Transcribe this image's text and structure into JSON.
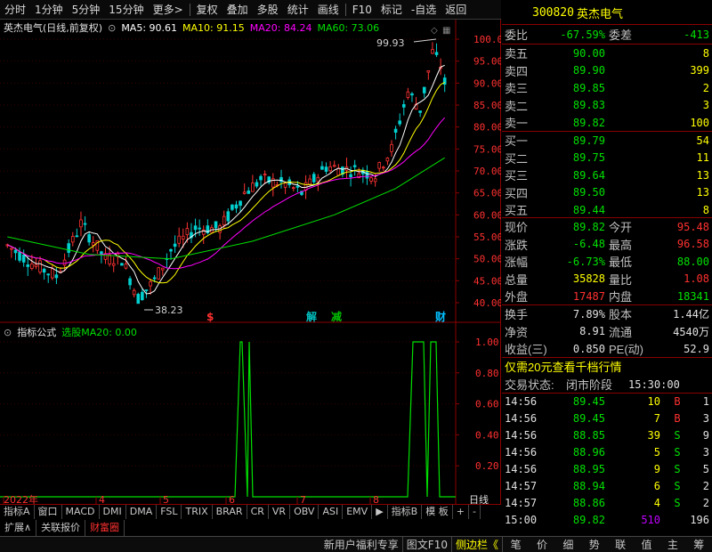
{
  "toolbar": {
    "items": [
      "分时",
      "1分钟",
      "5分钟",
      "15分钟",
      "更多>",
      "复权",
      "叠加",
      "多股",
      "统计",
      "画线",
      "F10",
      "标记",
      "-自选",
      "返回"
    ]
  },
  "chart": {
    "stock_label": "英杰电气(日线,前复权)",
    "ma5": "MA5: 90.61",
    "ma10": "MA10: 91.15",
    "ma20": "MA20: 84.24",
    "ma60": "MA60: 73.06",
    "price_axis": [
      "100.0",
      "95.00",
      "90.00",
      "85.00",
      "80.00",
      "75.00",
      "70.00",
      "65.00",
      "60.00",
      "55.00",
      "50.00",
      "45.00",
      "40.00"
    ],
    "high_label": "99.93",
    "low_label": "38.23",
    "event_markers": [
      {
        "text": "$",
        "color": "#ff3030"
      },
      {
        "text": "解",
        "color": "#00c0c0"
      },
      {
        "text": "减",
        "color": "#00c000"
      },
      {
        "text": "财",
        "color": "#00c0ff"
      }
    ],
    "indicator_title": "指标公式",
    "indicator_value": "选股MA20: 0.00",
    "indicator_axis": [
      "1.00",
      "0.80",
      "0.60",
      "0.40",
      "0.20"
    ],
    "date_axis": [
      "2022年",
      "4",
      "5",
      "6",
      "7",
      "8"
    ],
    "period_label": "日线",
    "colors": {
      "up": "#ff3232",
      "down": "#00d0d0",
      "ma5": "#ffffff",
      "ma10": "#ffff00",
      "ma20": "#ff00ff",
      "ma60": "#00e000",
      "axis": "#8b0000"
    }
  },
  "tabs": {
    "row1": [
      "指标A",
      "窗口",
      "MACD",
      "DMI",
      "DMA",
      "FSL",
      "TRIX",
      "BRAR",
      "CR",
      "VR",
      "OBV",
      "ASI",
      "EMV",
      "▶",
      "指标B",
      "模 板",
      "+",
      "-"
    ],
    "row2": [
      "扩展∧",
      "关联报价",
      "财富圈"
    ]
  },
  "bottom_bar": {
    "promo": "新用户福利专享",
    "f10": "图文F10",
    "sidebar": "侧边栏《",
    "right_items": [
      "笔",
      "价",
      "细",
      "势",
      "联",
      "值",
      "主",
      "筹"
    ]
  },
  "quote": {
    "code": "300820",
    "name": "英杰电气",
    "weibi_label": "委比",
    "weibi": "-67.59%",
    "weicha_label": "委差",
    "weicha": "-413",
    "sells": [
      {
        "label": "卖五",
        "price": "90.00",
        "vol": "8"
      },
      {
        "label": "卖四",
        "price": "89.90",
        "vol": "399"
      },
      {
        "label": "卖三",
        "price": "89.85",
        "vol": "2"
      },
      {
        "label": "卖二",
        "price": "89.83",
        "vol": "3"
      },
      {
        "label": "卖一",
        "price": "89.82",
        "vol": "100"
      }
    ],
    "buys": [
      {
        "label": "买一",
        "price": "89.79",
        "vol": "54"
      },
      {
        "label": "买二",
        "price": "89.75",
        "vol": "11"
      },
      {
        "label": "买三",
        "price": "89.64",
        "vol": "13"
      },
      {
        "label": "买四",
        "price": "89.50",
        "vol": "13"
      },
      {
        "label": "买五",
        "price": "89.44",
        "vol": "8"
      }
    ],
    "stats": [
      {
        "l1": "现价",
        "v1": "89.82",
        "c1": "#00e000",
        "l2": "今开",
        "v2": "95.48",
        "c2": "#ff3030"
      },
      {
        "l1": "涨跌",
        "v1": "-6.48",
        "c1": "#00e000",
        "l2": "最高",
        "v2": "96.58",
        "c2": "#ff3030"
      },
      {
        "l1": "涨幅",
        "v1": "-6.73%",
        "c1": "#00e000",
        "l2": "最低",
        "v2": "88.00",
        "c2": "#00e000"
      },
      {
        "l1": "总量",
        "v1": "35828",
        "c1": "#ffff00",
        "l2": "量比",
        "v2": "1.08",
        "c2": "#ff3030"
      },
      {
        "l1": "外盘",
        "v1": "17487",
        "c1": "#ff3030",
        "l2": "内盘",
        "v2": "18341",
        "c2": "#00e000"
      }
    ],
    "stats2": [
      {
        "l1": "换手",
        "v1": "7.89%",
        "l2": "股本",
        "v2": "1.44亿"
      },
      {
        "l1": "净资",
        "v1": "8.91",
        "l2": "流通",
        "v2": "4540万"
      },
      {
        "l1": "收益(三)",
        "v1": "0.850",
        "l2": "PE(动)",
        "v2": "52.9"
      }
    ],
    "promo": "仅需20元查看千档行情",
    "trade_status_label": "交易状态:",
    "trade_status": "闭市阶段",
    "trade_time": "15:30:00",
    "ticks": [
      {
        "t": "14:56",
        "p": "89.45",
        "v": "10",
        "bs": "B",
        "n": "1"
      },
      {
        "t": "14:56",
        "p": "89.45",
        "v": "7",
        "bs": "B",
        "n": "3"
      },
      {
        "t": "14:56",
        "p": "88.85",
        "v": "39",
        "bs": "S",
        "n": "9"
      },
      {
        "t": "14:56",
        "p": "88.96",
        "v": "5",
        "bs": "S",
        "n": "3"
      },
      {
        "t": "14:56",
        "p": "88.95",
        "v": "9",
        "bs": "S",
        "n": "5"
      },
      {
        "t": "14:57",
        "p": "88.94",
        "v": "6",
        "bs": "S",
        "n": "2"
      },
      {
        "t": "14:57",
        "p": "88.86",
        "v": "4",
        "bs": "S",
        "n": "2"
      },
      {
        "t": "15:00",
        "p": "89.82",
        "v": "510",
        "bs": "",
        "n": "196"
      }
    ]
  }
}
